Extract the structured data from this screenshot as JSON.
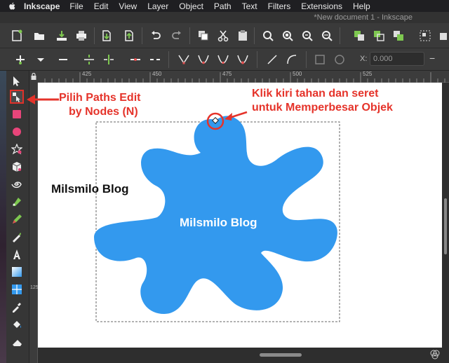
{
  "menubar": {
    "app_name": "Inkscape",
    "items": [
      "File",
      "Edit",
      "View",
      "Layer",
      "Object",
      "Path",
      "Text",
      "Filters",
      "Extensions",
      "Help"
    ]
  },
  "window": {
    "title": "*New document 1 - Inkscape"
  },
  "controls": {
    "x_label": "X:",
    "x_value": "0.000",
    "x_minus": "−"
  },
  "ruler": {
    "top_ticks": [
      "425",
      "450",
      "475",
      "500",
      "525"
    ],
    "left_tick": "125"
  },
  "annotations": {
    "tool_note_line1": "Pilih Paths Edit",
    "tool_note_line2": "by Nodes (N)",
    "node_note_line1": "Klik kiri tahan dan seret",
    "node_note_line2": "untuk Memperbesar Objek"
  },
  "canvas": {
    "label_left": "Milsmilo Blog",
    "label_shape": "Milsmilo Blog",
    "shape_color": "#3399ee",
    "accent_color": "#e5332a"
  }
}
